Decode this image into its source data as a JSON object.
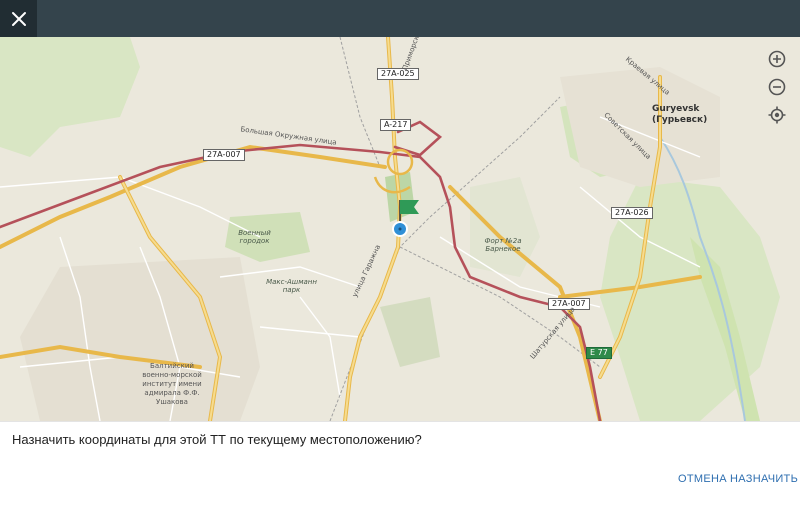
{
  "topbar": {
    "close_icon": "close-icon"
  },
  "map": {
    "roads": {
      "r1": "27A-025",
      "r2": "A-217",
      "r3": "27A-007",
      "r4": "27A-026",
      "r5": "27A-007",
      "r6": "E 77"
    },
    "streets": {
      "s1": "Большая Окружная улица",
      "s2": "Приморская",
      "s3": "улица Гаражна",
      "s4": "Шатурская улица",
      "s5": "Советская улица",
      "s6": "Краевая улица"
    },
    "places": {
      "p1": "Военный городок",
      "p2": "Макс-Ашманн парк",
      "p3": "Форт №2а Барнекое",
      "p4": "Балтийский военно-морской институт имени адмирала Ф.Ф. Ушакова"
    },
    "city": {
      "line1": "Guryevsk",
      "line2": "(Гурьевск)"
    },
    "controls": {
      "zoom_in": "zoom-in-icon",
      "zoom_out": "zoom-out-icon",
      "locate": "locate-icon"
    },
    "colors": {
      "highway": "#b5515a",
      "major_road": "#f0c96a",
      "flag": "#2f9a57",
      "location_dot": "#2f8fd6"
    }
  },
  "dialog": {
    "prompt": "Назначить координаты для этой ТТ по текущему местоположению?",
    "cancel_label": "ОТМЕНА",
    "assign_label": "НАЗНАЧИТЬ"
  }
}
